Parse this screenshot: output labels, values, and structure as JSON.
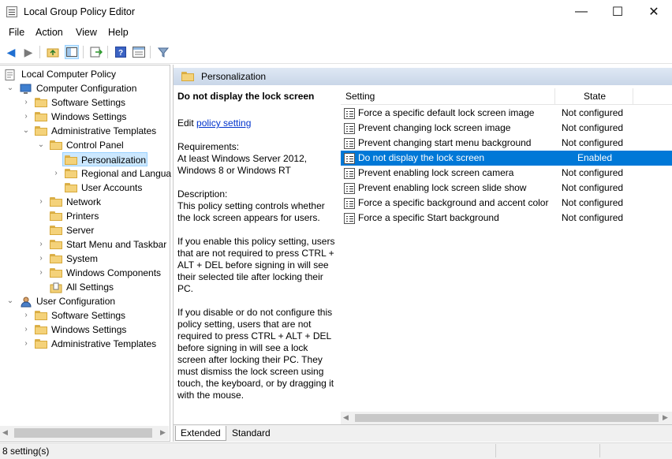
{
  "window": {
    "title": "Local Group Policy Editor",
    "minimize": "—",
    "maximize": "☐",
    "close": "✕"
  },
  "menu": {
    "file": "File",
    "action": "Action",
    "view": "View",
    "help": "Help"
  },
  "tree": {
    "root": "Local Computer Policy",
    "computer_config": "Computer Configuration",
    "cc_software": "Software Settings",
    "cc_windows": "Windows Settings",
    "cc_admin": "Administrative Templates",
    "control_panel": "Control Panel",
    "personalization": "Personalization",
    "regional": "Regional and Langua",
    "user_accounts": "User Accounts",
    "network": "Network",
    "printers": "Printers",
    "server": "Server",
    "start_menu": "Start Menu and Taskbar",
    "system": "System",
    "windows_components": "Windows Components",
    "all_settings": "All Settings",
    "user_config": "User Configuration",
    "uc_software": "Software Settings",
    "uc_windows": "Windows Settings",
    "uc_admin": "Administrative Templates"
  },
  "pane": {
    "header": "Personalization",
    "desc_title": "Do not display the lock screen",
    "edit_prefix": "Edit ",
    "edit_link": "policy setting",
    "req_label": "Requirements:",
    "req_text": "At least Windows Server 2012, Windows 8 or Windows RT",
    "desc_label": "Description:",
    "desc_1": "This policy setting controls whether the lock screen appears for users.",
    "desc_2": "If you enable this policy setting, users that are not required to press CTRL + ALT + DEL before signing in will see their selected tile after  locking their PC.",
    "desc_3": "If you disable or do not configure this policy setting, users that are not required to press CTRL + ALT + DEL before signing in will see a lock screen after locking their PC. They must dismiss the lock screen using touch, the keyboard, or by dragging it with the mouse."
  },
  "list": {
    "col_setting": "Setting",
    "col_state": "State",
    "rows": [
      {
        "name": "Force a specific default lock screen image",
        "state": "Not configured"
      },
      {
        "name": "Prevent changing lock screen image",
        "state": "Not configured"
      },
      {
        "name": "Prevent changing start menu background",
        "state": "Not configured"
      },
      {
        "name": "Do not display the lock screen",
        "state": "Enabled"
      },
      {
        "name": "Prevent enabling lock screen camera",
        "state": "Not configured"
      },
      {
        "name": "Prevent enabling lock screen slide show",
        "state": "Not configured"
      },
      {
        "name": "Force a specific background and accent color",
        "state": "Not configured"
      },
      {
        "name": "Force a specific Start background",
        "state": "Not configured"
      }
    ]
  },
  "tabs": {
    "extended": "Extended",
    "standard": "Standard"
  },
  "status": {
    "text": "8 setting(s)"
  },
  "colors": {
    "selection": "#0078d7",
    "tree_selection": "#cce8ff",
    "folder": "#f4d27a"
  }
}
